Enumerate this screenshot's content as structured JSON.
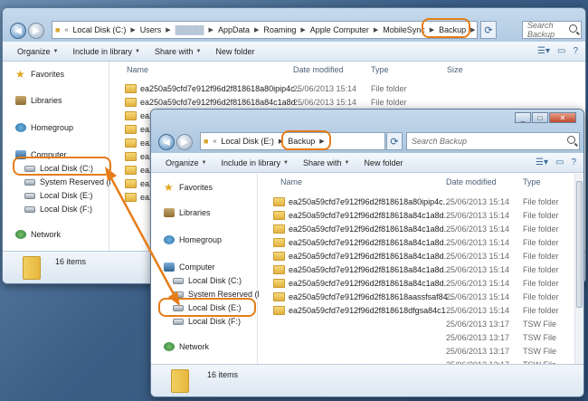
{
  "back_window": {
    "address": [
      "Local Disk (C:)",
      "Users",
      "AppData",
      "Roaming",
      "Apple Computer",
      "MobileSync",
      "Backup"
    ],
    "search_placeholder": "Search Backup",
    "toolbar": {
      "organize": "Organize",
      "include": "Include in library",
      "share": "Share with",
      "new_folder": "New folder"
    },
    "columns": {
      "name": "Name",
      "date": "Date modified",
      "type": "Type",
      "size": "Size"
    },
    "nav": {
      "favorites": "Favorites",
      "libraries": "Libraries",
      "homegroup": "Homegroup",
      "computer": "Computer",
      "drives": [
        "Local Disk (C:)",
        "System Reserved (D:)",
        "Local Disk (E:)",
        "Local Disk (F:)"
      ],
      "network": "Network"
    },
    "rows": [
      {
        "name": "ea250a59cfd7e912f96d2f818618a80ipip4c...",
        "date": "25/06/2013 15:14",
        "type": "File folder"
      },
      {
        "name": "ea250a59cfd7e912f96d2f818618a84c1a8d...",
        "date": "25/06/2013 15:14",
        "type": "File folder"
      },
      {
        "name": "ea250a59cfd7e912f96d2f818618a84c1a8d...",
        "date": "",
        "type": ""
      },
      {
        "name": "ea250a59cfd7e912f96d2f818618a84c1a8d...",
        "date": "",
        "type": ""
      },
      {
        "name": "ea250a59cfd7e912f96d2f818618a84c1a8d...",
        "date": "",
        "type": ""
      },
      {
        "name": "ea250a59cfd7e912f96d2f818618a84c1a8d...",
        "date": "",
        "type": ""
      },
      {
        "name": "ea250a59cfd7e912f96d2f818618a84c1a8d...",
        "date": "",
        "type": ""
      },
      {
        "name": "ea250a59cfd7e912f96d2f818618a84c1a8d...",
        "date": "",
        "type": ""
      },
      {
        "name": "ea250a59cfd7e912f96d2f818618a84c1a8d...",
        "date": "",
        "type": ""
      }
    ],
    "status": "16 items"
  },
  "front_window": {
    "address": [
      "Local Disk (E:)",
      "Backup"
    ],
    "search_placeholder": "Search Backup",
    "toolbar": {
      "organize": "Organize",
      "include": "Include in library",
      "share": "Share with",
      "new_folder": "New folder"
    },
    "columns": {
      "name": "Name",
      "date": "Date modified",
      "type": "Type"
    },
    "nav": {
      "favorites": "Favorites",
      "libraries": "Libraries",
      "homegroup": "Homegroup",
      "computer": "Computer",
      "drives": [
        "Local Disk (C:)",
        "System Reserved (D:)",
        "Local Disk (E:)",
        "Local Disk (F:)"
      ],
      "network": "Network"
    },
    "rows": [
      {
        "name": "ea250a59cfd7e912f96d2f818618a80ipip4c...",
        "date": "25/06/2013 15:14",
        "type": "File folder",
        "icon": "folder"
      },
      {
        "name": "ea250a59cfd7e912f96d2f818618a84c1a8d...",
        "date": "25/06/2013 15:14",
        "type": "File folder",
        "icon": "folder"
      },
      {
        "name": "ea250a59cfd7e912f96d2f818618a84c1a8d...",
        "date": "25/06/2013 15:14",
        "type": "File folder",
        "icon": "folder"
      },
      {
        "name": "ea250a59cfd7e912f96d2f818618a84c1a8d...",
        "date": "25/06/2013 15:14",
        "type": "File folder",
        "icon": "folder"
      },
      {
        "name": "ea250a59cfd7e912f96d2f818618a84c1a8d...",
        "date": "25/06/2013 15:14",
        "type": "File folder",
        "icon": "folder"
      },
      {
        "name": "ea250a59cfd7e912f96d2f818618a84c1a8d...",
        "date": "25/06/2013 15:14",
        "type": "File folder",
        "icon": "folder"
      },
      {
        "name": "ea250a59cfd7e912f96d2f818618a84c1a8d...",
        "date": "25/06/2013 15:14",
        "type": "File folder",
        "icon": "folder"
      },
      {
        "name": "ea250a59cfd7e912f96d2f818618aassfsaf84...",
        "date": "25/06/2013 15:14",
        "type": "File folder",
        "icon": "folder"
      },
      {
        "name": "ea250a59cfd7e912f96d2f818618dfgsa84c1...",
        "date": "25/06/2013 15:14",
        "type": "File folder",
        "icon": "folder"
      },
      {
        "name": "",
        "date": "25/06/2013 13:17",
        "type": "TSW File",
        "icon": "none"
      },
      {
        "name": "",
        "date": "25/06/2013 13:17",
        "type": "TSW File",
        "icon": "none"
      },
      {
        "name": "",
        "date": "25/06/2013 13:17",
        "type": "TSW File",
        "icon": "none"
      },
      {
        "name": "",
        "date": "25/06/2013 13:17",
        "type": "TSW File",
        "icon": "none"
      }
    ],
    "status": "16 items"
  },
  "colors": {
    "highlight": "#e57c19",
    "arrow": "#e57c19"
  },
  "icons": [
    "back-arrow-icon",
    "forward-arrow-icon",
    "folder-icon",
    "star-icon",
    "library-icon",
    "homegroup-icon",
    "computer-icon",
    "drive-icon",
    "network-icon",
    "search-icon",
    "refresh-icon",
    "help-icon"
  ]
}
